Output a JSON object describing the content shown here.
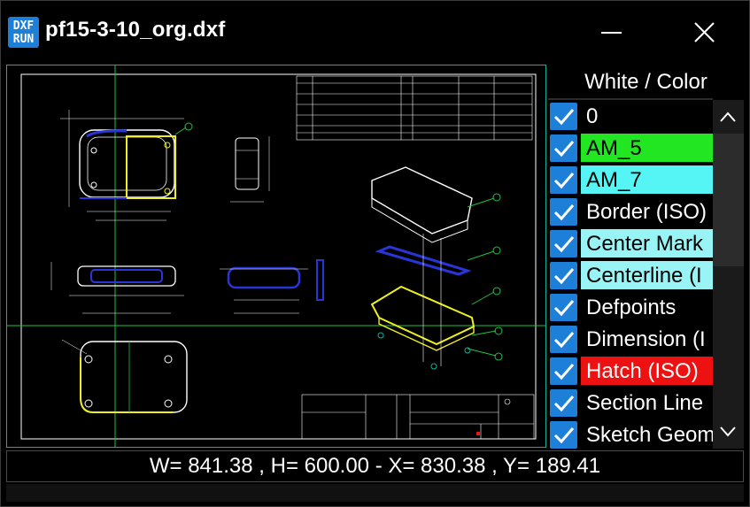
{
  "window": {
    "title": "pf15-3-10_org.dxf",
    "logo_line1": "DXF",
    "logo_line2": "RUN"
  },
  "panel": {
    "header": "White / Color",
    "layers": [
      {
        "name": "0",
        "checked": true,
        "bg": ""
      },
      {
        "name": "AM_5",
        "checked": true,
        "bg": "#22e622"
      },
      {
        "name": "AM_7",
        "checked": true,
        "bg": "#55f5f5"
      },
      {
        "name": "Border (ISO)",
        "checked": true,
        "bg": ""
      },
      {
        "name": "Center Mark",
        "checked": true,
        "bg": "#99f5f5"
      },
      {
        "name": "Centerline (I",
        "checked": true,
        "bg": "#99f5f5"
      },
      {
        "name": "Defpoints",
        "checked": true,
        "bg": ""
      },
      {
        "name": "Dimension (I",
        "checked": true,
        "bg": ""
      },
      {
        "name": "Hatch (ISO)",
        "checked": true,
        "bg": "#ee1111"
      },
      {
        "name": "Section Line",
        "checked": true,
        "bg": ""
      },
      {
        "name": "Sketch Geom",
        "checked": true,
        "bg": ""
      }
    ]
  },
  "status": {
    "text": "W= 841.38 , H= 600.00 - X= 830.38 , Y= 189.41"
  },
  "colors": {
    "accent": "#1e7fd8",
    "frame": "#0fb39a",
    "yellow": "#f0f020",
    "blue": "#2a35d8",
    "green": "#20c040"
  },
  "icons": {
    "minimize": "minimize-icon",
    "close": "close-icon",
    "check": "check-icon",
    "up": "chevron-up-icon",
    "down": "chevron-down-icon"
  }
}
